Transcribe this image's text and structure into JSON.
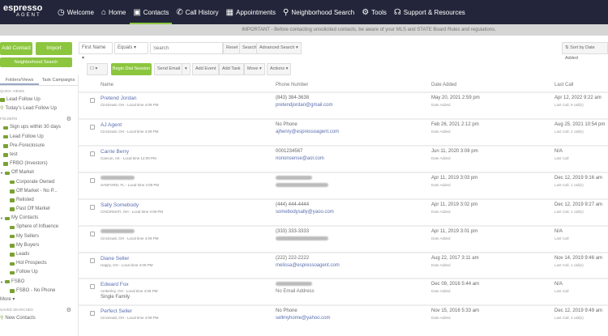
{
  "nav": {
    "logo": "espresso",
    "logo_sub": "AGENT",
    "items": [
      {
        "label": "Welcome",
        "icon": "clock-icon",
        "glyph": "◷"
      },
      {
        "label": "Home",
        "icon": "home-icon",
        "glyph": "⌂"
      },
      {
        "label": "Contacts",
        "icon": "contacts-icon",
        "glyph": "▣",
        "active": true
      },
      {
        "label": "Call History",
        "icon": "phone-icon",
        "glyph": "✆"
      },
      {
        "label": "Appointments",
        "icon": "calendar-icon",
        "glyph": "▦"
      },
      {
        "label": "Neighborhood Search",
        "icon": "search-icon",
        "glyph": "⚲"
      },
      {
        "label": "Tools",
        "icon": "gear-icon",
        "glyph": "⚙"
      },
      {
        "label": "Support & Resources",
        "icon": "headset-icon",
        "glyph": "☊"
      }
    ]
  },
  "banner": "IMPORTANT - Before contacting unsolicited contacts, be aware of your MLS and STATE Board Rules and regulations.",
  "actions": {
    "add_contact": "Add Contact",
    "import": "Import",
    "neighborhood_search": "Neighborhood Search"
  },
  "search": {
    "field": "First Name",
    "operator": "Equals",
    "placeholder": "Search",
    "reset": "Reset",
    "search": "Search",
    "advanced": "Advanced Search ▾",
    "sort": "Sort by Date Added"
  },
  "toolbar": {
    "begin_dial": "Begin Dial Session",
    "send_email": "Send Email",
    "add_event": "Add Event",
    "add_task": "Add Task",
    "move": "Move ▾",
    "actions": "Actions ▾"
  },
  "sidebar": {
    "tabs": [
      "Folders/Views",
      "Task Campaigns"
    ],
    "quick_views_label": "QUICK VIEWS",
    "quick_views": [
      "Lead Follow Up",
      "Today's Lead Follow Up"
    ],
    "folders_label": "FOLDERS",
    "folders": [
      {
        "label": "Sign ups within 30 days",
        "lvl": 1
      },
      {
        "label": "Lead Follow Up",
        "lvl": 1
      },
      {
        "label": "Pre-Foreclosure",
        "lvl": 1
      },
      {
        "label": "test",
        "lvl": 1
      },
      {
        "label": "FRBO (Investors)",
        "lvl": 1
      },
      {
        "label": "Off Market",
        "lvl": 0
      },
      {
        "label": "Corporate Owned",
        "lvl": 2
      },
      {
        "label": "Off Market - No P...",
        "lvl": 2
      },
      {
        "label": "Relisted",
        "lvl": 2
      },
      {
        "label": "Past Off Market",
        "lvl": 2
      },
      {
        "label": "My Contacts",
        "lvl": 0
      },
      {
        "label": "Sphere of Influence",
        "lvl": 2
      },
      {
        "label": "My Sellers",
        "lvl": 2
      },
      {
        "label": "My Buyers",
        "lvl": 2
      },
      {
        "label": "Leads",
        "lvl": 2
      },
      {
        "label": "Hot Prospects",
        "lvl": 2
      },
      {
        "label": "Follow Up",
        "lvl": 2
      },
      {
        "label": "FSBO",
        "lvl": 0
      },
      {
        "label": "FSBO - No Phone",
        "lvl": 2
      }
    ],
    "more": "More ▾",
    "saved_label": "SAVED SEARCHES",
    "saved": [
      "New Contacts"
    ]
  },
  "table": {
    "headers": [
      "Name",
      "Phone Number",
      "Date Added",
      "Last Call"
    ],
    "rows": [
      {
        "name": "Pretend Jordan",
        "loc": "Cincinnati, OH - Local time 4:09 PM",
        "phone": "(843) 384-3638",
        "email": "pretendjordan@gmail.com",
        "date": "May 20, 2021 2:59 pm",
        "date_sub": "Date Added",
        "last": "Apr 12, 2022 9:22 am",
        "last_sub": "Last Call, 9 call(s)"
      },
      {
        "name": "AJ Agent",
        "loc": "Cincinnati, OH - Local time 4:09 PM",
        "phone": "No Phone",
        "email": "ajhenry@espressoagent.com",
        "date": "Feb 26, 2021 2:12 pm",
        "date_sub": "Date Added",
        "last": "Aug 25, 2021 10:54 pm",
        "last_sub": "Last Call, 2 call(s)"
      },
      {
        "name": "Carrie Berry",
        "loc": "Cancun, AK - Local time 12:09 PM",
        "phone": "0001234567",
        "email": "nononsense@aol.com",
        "date": "Jun 11, 2020 3:08 pm",
        "date_sub": "Date Added",
        "last": "N/A",
        "last_sub": "Last Call"
      },
      {
        "name": "",
        "loc": "SANFORD, FL - Local time 4:09 PM",
        "phone": "",
        "email": "",
        "date": "Apr 11, 2019 3:03 pm",
        "date_sub": "Date Added",
        "last": "Dec 12, 2019 9:16 am",
        "last_sub": "Last Call, 1 call(s)",
        "blur": true
      },
      {
        "name": "Sally Somebody",
        "loc": "CINCINNATI, OH - Local time 4:09 PM",
        "phone": "(444) 444-4444",
        "email": "somebodysally@yaoo.com",
        "date": "Apr 11, 2019 3:02 pm",
        "date_sub": "Date Added",
        "last": "Dec 12, 2019 9:27 am",
        "last_sub": "Last Call, 1 call(s)"
      },
      {
        "name": "",
        "loc": "Cincinnati, OH - Local time 4:09 PM",
        "phone": "(333) 333-3333",
        "email": "",
        "date": "Apr 11, 2019 3:01 pm",
        "date_sub": "Date Added",
        "last": "N/A",
        "last_sub": "Last Call",
        "blur": true
      },
      {
        "name": "Diane Seller",
        "loc": "Happy, OH - Local time 4:09 PM",
        "phone": "(222) 222-2222",
        "email": "melissa@espressoagent.com",
        "date": "Aug 22, 2017 3:11 am",
        "date_sub": "Date Added",
        "last": "Nov 14, 2019 9:46 am",
        "last_sub": "Last Call, 1 call(s)"
      },
      {
        "name": "Edward Fox",
        "loc": "Amberley, OH - Local time 4:09 PM",
        "extra": "Single Family",
        "phone": "",
        "email": "No Email Address",
        "date": "Dec 09, 2016 5:44 am",
        "date_sub": "Date Added",
        "last": "N/A",
        "last_sub": "Last Call",
        "blur": true
      },
      {
        "name": "Perfect Seller",
        "loc": "Cincinnati, OH - Local time 4:09 PM",
        "phone": "No Phone",
        "email": "sellmyhome@yahoo.com",
        "date": "Nov 15, 2016 5:33 am",
        "date_sub": "Date Added",
        "last": "Dec 12, 2019 9:49 am",
        "last_sub": "Last Call, 3 call(s)"
      }
    ]
  }
}
